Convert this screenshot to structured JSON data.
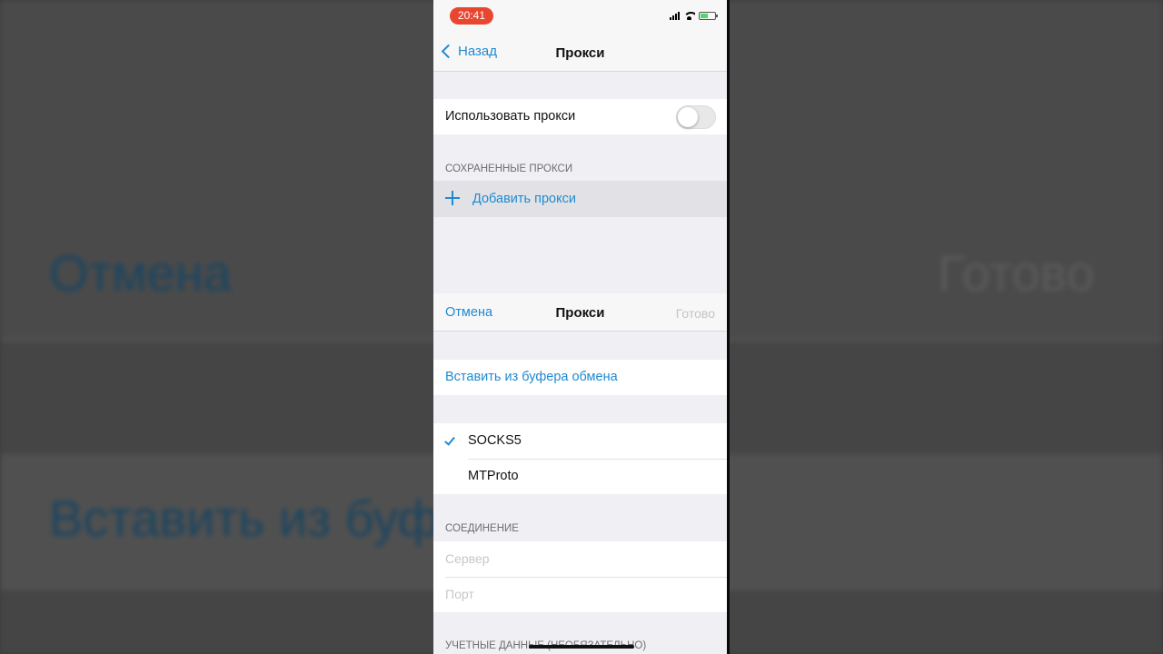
{
  "status_bar": {
    "time": "20:41"
  },
  "nav": {
    "back_label": "Назад",
    "title": "Прокси"
  },
  "use_proxy": {
    "label": "Использовать прокси",
    "enabled": false
  },
  "saved": {
    "header": "СОХРАНЕННЫЕ ПРОКСИ",
    "add_label": "Добавить прокси"
  },
  "modal": {
    "cancel_label": "Отмена",
    "title": "Прокси",
    "done_label": "Готово",
    "paste_label": "Вставить из буфера обмена",
    "types": [
      {
        "label": "SOCKS5",
        "selected": true
      },
      {
        "label": "MTProto",
        "selected": false
      }
    ],
    "connection_header": "СОЕДИНЕНИЕ",
    "server_placeholder": "Сервер",
    "port_placeholder": "Порт",
    "credentials_header": "УЧЕТНЫЕ ДАННЫЕ (НЕОБЯЗАТЕЛЬНО)"
  },
  "background": {
    "cancel_text": "Отмена",
    "done_text": "Готово",
    "paste_text": "Вставить из буфера обмена"
  },
  "colors": {
    "accent": "#1f8ad2",
    "time_pill": "#e8462f",
    "grouped_bg": "#efeff4"
  }
}
